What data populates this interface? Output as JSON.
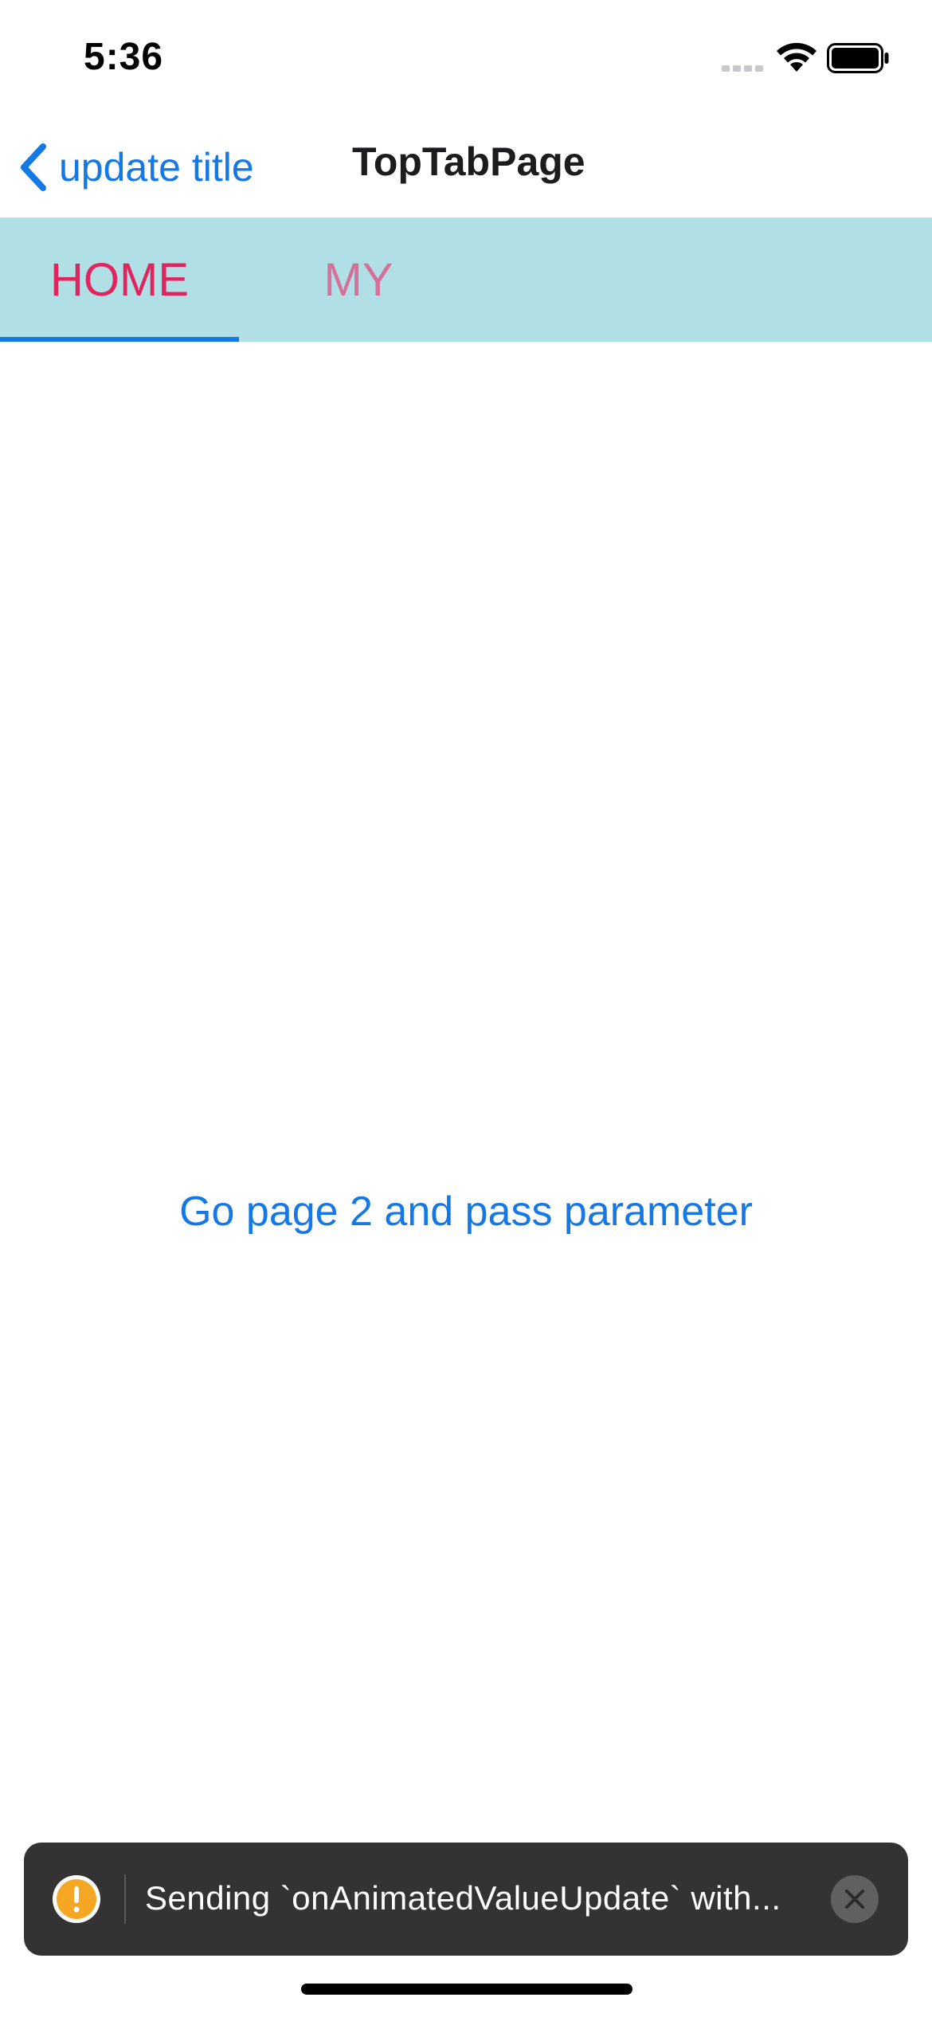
{
  "status_bar": {
    "time": "5:36",
    "signal_icon": "signal-dots-icon",
    "wifi_icon": "wifi-icon",
    "battery_icon": "battery-icon"
  },
  "nav": {
    "back_label": "update title",
    "back_icon": "chevron-left-icon",
    "title": "TopTabPage"
  },
  "tabs": [
    {
      "label": "HOME",
      "selected": true
    },
    {
      "label": "MY",
      "selected": false
    }
  ],
  "main": {
    "link_label": "Go page 2 and pass parameter"
  },
  "toast": {
    "icon": "warning-icon",
    "message": "Sending `onAnimatedValueUpdate` with...",
    "close_icon": "close-icon"
  },
  "colors": {
    "accent": "#1478e6",
    "tab_bar_bg": "#b0dfe5",
    "tab_active_text": "#e0245e",
    "tab_inactive_text": "#d6709a",
    "toast_bg": "#333333",
    "warning": "#f5a623"
  }
}
